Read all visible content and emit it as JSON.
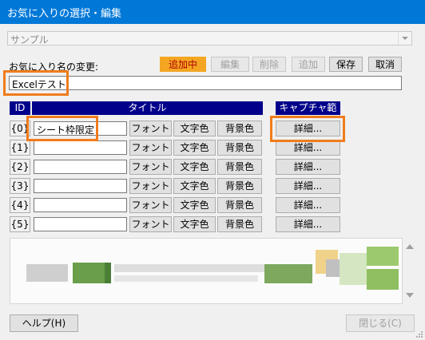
{
  "window": {
    "title": "お気に入りの選択・編集"
  },
  "profile_select": {
    "value": "サンプル"
  },
  "rename": {
    "label": "お気に入り名の変更:",
    "value": "Excelテスト"
  },
  "toolbar": {
    "add_active": "追加中",
    "edit": "編集",
    "delete": "削除",
    "add": "追加",
    "save": "保存",
    "cancel": "取消"
  },
  "table": {
    "headers": {
      "id": "ID",
      "title": "タイトル",
      "capture_range": "キャプチャ範囲"
    },
    "rows": [
      {
        "id": "{0}",
        "title": "シート枠限定",
        "font": "フォント",
        "text_color": "文字色",
        "bg_color": "背景色",
        "detail": "詳細..."
      },
      {
        "id": "{1}",
        "title": "",
        "font": "フォント",
        "text_color": "文字色",
        "bg_color": "背景色",
        "detail": "詳細..."
      },
      {
        "id": "{2}",
        "title": "",
        "font": "フォント",
        "text_color": "文字色",
        "bg_color": "背景色",
        "detail": "詳細..."
      },
      {
        "id": "{3}",
        "title": "",
        "font": "フォント",
        "text_color": "文字色",
        "bg_color": "背景色",
        "detail": "詳細..."
      },
      {
        "id": "{4}",
        "title": "",
        "font": "フォント",
        "text_color": "文字色",
        "bg_color": "背景色",
        "detail": "詳細..."
      },
      {
        "id": "{5}",
        "title": "",
        "font": "フォント",
        "text_color": "文字色",
        "bg_color": "背景色",
        "detail": "詳細..."
      }
    ]
  },
  "footer": {
    "help": "ヘルプ(H)",
    "close": "閉じる(C)"
  },
  "colors": {
    "titlebar": "#0078d7",
    "header_bg": "#00008b",
    "highlight": "#f07c1b",
    "add_active_bg": "#f4a623",
    "add_active_text": "#b00000"
  }
}
